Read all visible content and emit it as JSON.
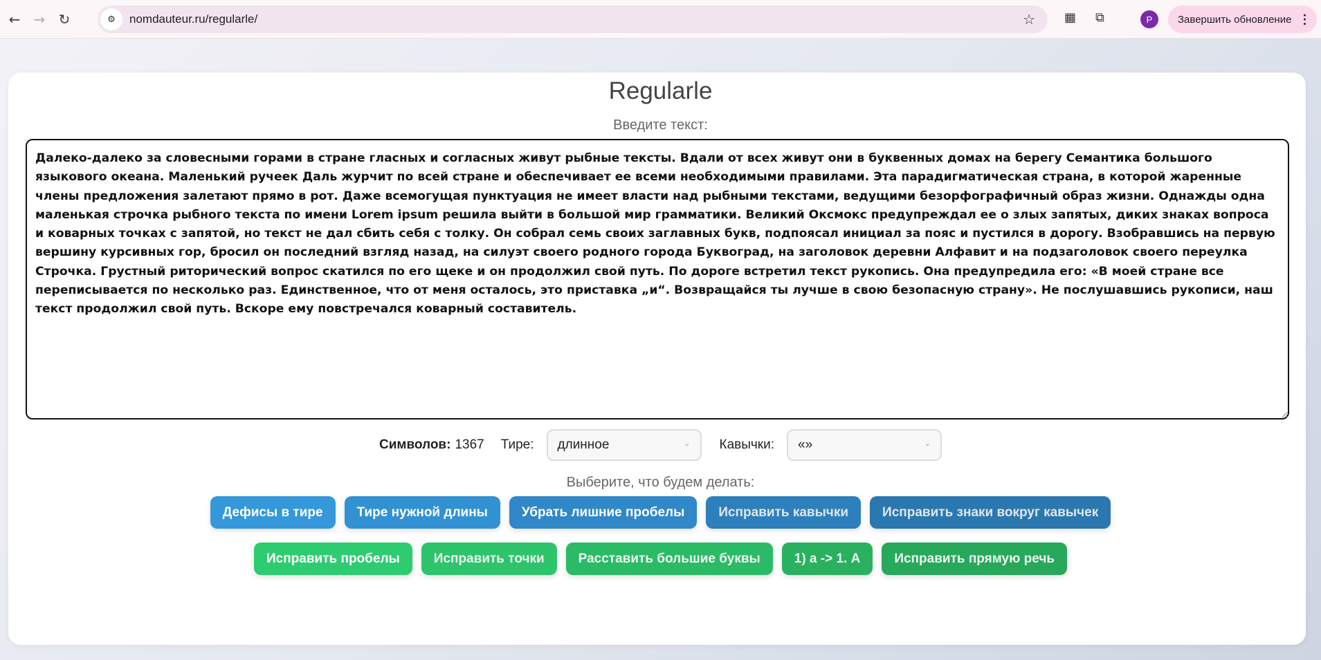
{
  "browser": {
    "url": "nomdauteur.ru/regularle/",
    "profile_initial": "P",
    "update_label": "Завершить обновление"
  },
  "page": {
    "title": "Regularle",
    "input_label": "Введите текст:",
    "text": "Далеко-далеко за словесными горами в стране гласных и согласных живут рыбные тексты. Вдали от всех живут они в буквенных домах на берегу Семантика большого языкового океана. Маленький ручеек Даль журчит по всей стране и обеспечивает ее всеми необходимыми правилами. Эта парадигматическая страна, в которой жаренные члены предложения залетают прямо в рот. Даже всемогущая пунктуация не имеет власти над рыбными текстами, ведущими безорфографичный образ жизни. Однажды одна маленькая строчка рыбного текста по имени Lorem ipsum решила выйти в большой мир грамматики. Великий Оксмокс предупреждал ее о злых запятых, диких знаках вопроса и коварных точках с запятой, но текст не дал сбить себя с толку. Он собрал семь своих заглавных букв, подпоясал инициал за пояс и пустился в дорогу. Взобравшись на первую вершину курсивных гор, бросил он последний взгляд назад, на силуэт своего родного города Буквоград, на заголовок деревни Алфавит и на подзаголовок своего переулка Строчка. Грустный риторический вопрос скатился по его щеке и он продолжил свой путь. По дороге встретил текст рукопись. Она предупредила его: «В моей стране все переписывается по несколько раз. Единственное, что от меня осталось, это приставка „и“. Возвращайся ты лучше в свою безопасную страну». Не послушавшись рукописи, наш текст продолжил свой путь. Вскоре ему повстречался коварный составитель.",
    "symbols_label": "Символов:",
    "symbols_count": "1367",
    "dash_label": "Тире:",
    "dash_value": "длинное",
    "quotes_label": "Кавычки:",
    "quotes_value": "«»",
    "choose_label": "Выберите, что будем делать:",
    "blue_buttons": [
      "Дефисы в тире",
      "Тире нужной длины",
      "Убрать лишние пробелы",
      "Исправить кавычки",
      "Исправить знаки вокруг кавычек"
    ],
    "green_buttons": [
      "Исправить пробелы",
      "Исправить точки",
      "Расставить большие буквы",
      "1) а -> 1. А",
      "Исправить прямую речь"
    ]
  },
  "colors": {
    "blue": [
      "#3498db",
      "#3291d3",
      "#3088c8",
      "#2d80bc",
      "#2b78b0"
    ],
    "green": [
      "#2ecc71",
      "#2dc46b",
      "#2bbb66",
      "#29b160",
      "#27a85b"
    ]
  }
}
